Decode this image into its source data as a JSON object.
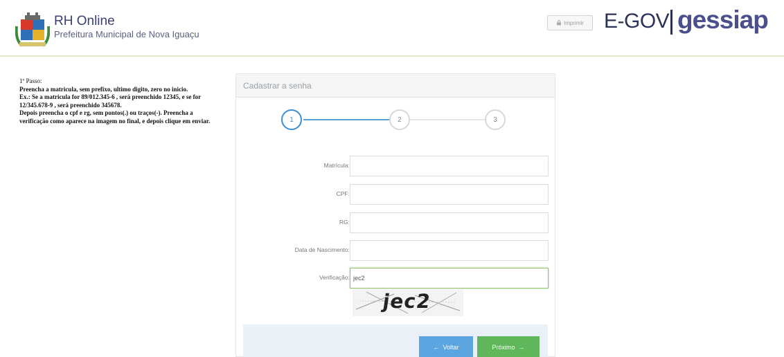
{
  "header": {
    "title": "RH Online",
    "subtitle": "Prefeitura Municipal de Nova Iguaçu",
    "print_label": "Imprimir",
    "egov": "E-GOV",
    "gessiap": "gessiap"
  },
  "instructions": {
    "heading": "1º Passo:",
    "line1": "Preencha a matricula, sem prefixo, ultimo digito, zero no inicio.",
    "line2": "Ex.: Se a matricula for 89/012.345-6 , será preenchido 12345, e se for 12/345.678-9 , será preenchido 345678.",
    "line3": "Depois preencha o cpf e rg, sem pontos(.) ou traços(-). Preencha a verificação como aparece na imagem no final, e depois clique em enviar."
  },
  "panel": {
    "title": "Cadastrar a senha",
    "steps": [
      "1",
      "2",
      "3"
    ],
    "active_step": 1
  },
  "form": {
    "matricula_label": "Matrícula:",
    "matricula_value": "",
    "cpf_label": "CPF:",
    "cpf_value": "",
    "rg_label": "RG:",
    "rg_value": "",
    "nascimento_label": "Data de Nascimento:",
    "nascimento_value": "",
    "verificacao_label": "Verificação:",
    "verificacao_value": "jec2"
  },
  "captcha": {
    "text": "jec2"
  },
  "buttons": {
    "voltar": "Voltar",
    "proximo": "Próximo"
  },
  "colors": {
    "primary": "#5ba6e0",
    "success": "#5fb65b",
    "brand": "#4b4f8c"
  }
}
